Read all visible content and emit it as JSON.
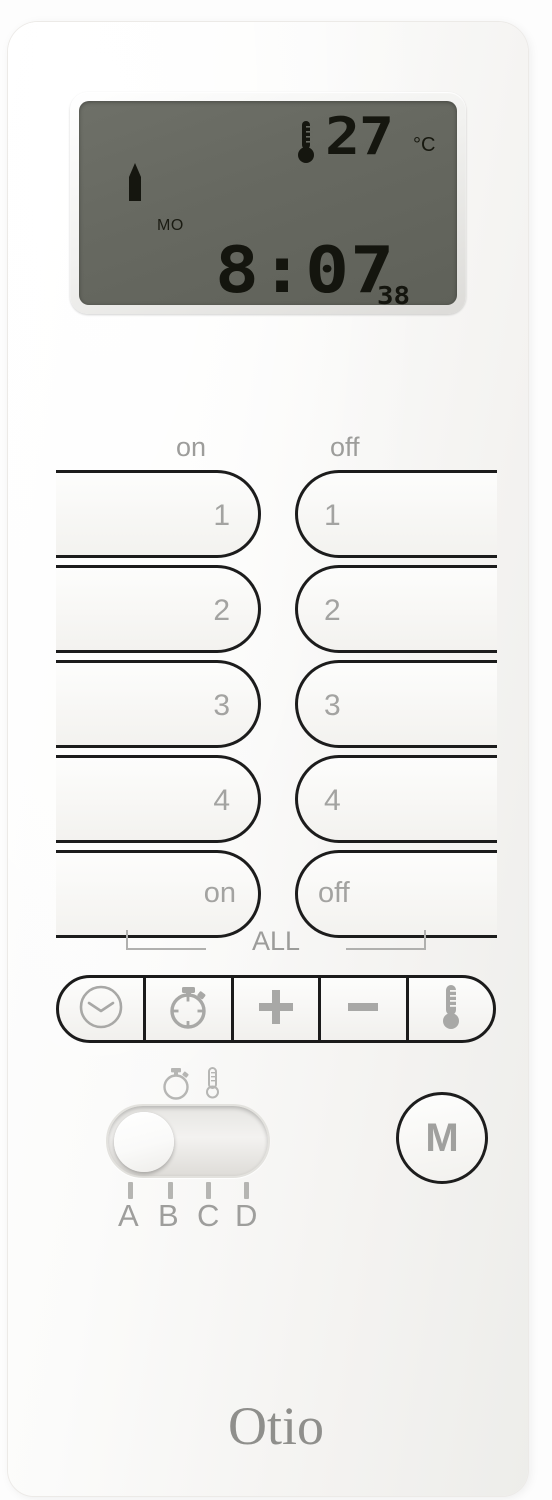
{
  "device": {
    "brand": "Otio",
    "type": "remote-control-timer"
  },
  "lcd": {
    "temperature": "27",
    "temperature_unit": "°C",
    "thermometer_icon": "thermometer-icon",
    "antenna_icon": "antenna-icon",
    "day": "MO",
    "time": "8:07",
    "seconds": "38",
    "screen_color": "#676961",
    "segment_color": "#15160f"
  },
  "columns": {
    "on_label": "on",
    "off_label": "off"
  },
  "channels": [
    {
      "on": "1",
      "off": "1"
    },
    {
      "on": "2",
      "off": "2"
    },
    {
      "on": "3",
      "off": "3"
    },
    {
      "on": "4",
      "off": "4"
    },
    {
      "on": "on",
      "off": "off"
    }
  ],
  "all_group": {
    "label": "ALL"
  },
  "function_buttons": [
    {
      "name": "clock-button",
      "icon": "clock-icon"
    },
    {
      "name": "timer-button",
      "icon": "stopwatch-icon"
    },
    {
      "name": "plus-button",
      "icon": "plus-icon"
    },
    {
      "name": "minus-button",
      "icon": "minus-icon"
    },
    {
      "name": "thermometer-button",
      "icon": "thermometer-icon"
    }
  ],
  "mode_slider": {
    "icons": [
      "stopwatch-icon",
      "thermometer-icon"
    ],
    "positions": [
      "A",
      "B",
      "C",
      "D"
    ],
    "selected": "A"
  },
  "memory_button": {
    "label": "M"
  },
  "colors": {
    "body": "#fbfbfa",
    "outline": "#1c1c1c",
    "label_gray": "#a0a09e",
    "lcd": "#676961"
  }
}
